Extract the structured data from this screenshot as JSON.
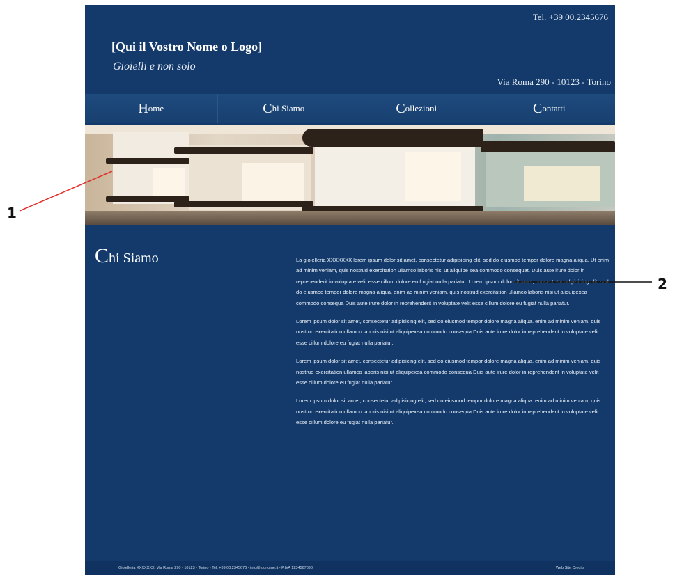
{
  "header": {
    "tel": "Tel. +39 00.2345676",
    "logo_text": "[Qui il Vostro Nome o Logo]",
    "tagline": "Gioielli e non solo",
    "address": "Via Roma 290 - 10123 - Torino"
  },
  "nav": {
    "items": [
      {
        "cap": "H",
        "rest": "ome"
      },
      {
        "cap": "C",
        "rest": "hi Siamo"
      },
      {
        "cap": "C",
        "rest": "ollezioni"
      },
      {
        "cap": "C",
        "rest": "ontatti"
      }
    ]
  },
  "section": {
    "title_cap": "C",
    "title_rest": "hi Siamo"
  },
  "content": {
    "paragraphs": [
      "La gioielleria XXXXXXX lorem ipsum dolor sit amet, consectetur adipisicing elit, sed do eiusmod tempor dolore magna aliqua. Ut enim ad minim veniam, quis nostrud exercitation ullamco laboris nisi ut aliquipe sea commodo consequat. Duis aute irure dolor in reprehenderit in voluptate velit esse cillum dolore eu f ugiat nulla pariatur. Lorem ipsum dolor sit amet, consectetur adipisicing elit, sed do eiusmod tempor dolore magna aliqua. enim ad minim veniam, quis nostrud exercitation ullamco laboris nisi ut aliquipexea commodo consequa Duis aute irure dolor in reprehenderit in voluptate velit esse cillum dolore eu fugiat nulla pariatur.",
      "Lorem ipsum dolor sit amet, consectetur adipisicing elit, sed do eiusmod tempor dolore magna aliqua. enim ad minim veniam, quis nostrud exercitation ullamco laboris nisi ut aliquipexea commodo consequa Duis aute irure dolor in reprehenderit in voluptate velit esse cillum dolore eu fugiat nulla pariatur.",
      "Lorem ipsum dolor sit amet, consectetur adipisicing elit, sed do eiusmod tempor dolore magna aliqua. enim ad minim veniam, quis nostrud exercitation ullamco laboris nisi ut aliquipexea commodo consequa Duis aute irure dolor in reprehenderit in voluptate velit esse cillum dolore eu fugiat nulla pariatur.",
      "Lorem ipsum dolor sit amet, consectetur adipisicing elit, sed do eiusmod tempor dolore magna aliqua. enim ad minim veniam, quis nostrud exercitation ullamco laboris nisi ut aliquipexea commodo consequa Duis aute irure dolor in reprehenderit in voluptate velit esse cillum dolore eu fugiat nulla pariatur."
    ]
  },
  "footer": {
    "left": "Gioielleria XXXXXXX, Via Roma 290 - 10123 - Torino - Tel. +39 00.2345676 - info@tuonome.it - P.IVA 1234567890",
    "right": "Web Site Credits"
  },
  "annotations": {
    "label_1": "1",
    "label_2": "2",
    "line_color": "#e0302b"
  },
  "colors": {
    "page_bg": "#133a6b",
    "nav_bg": "#1f4a7e"
  }
}
